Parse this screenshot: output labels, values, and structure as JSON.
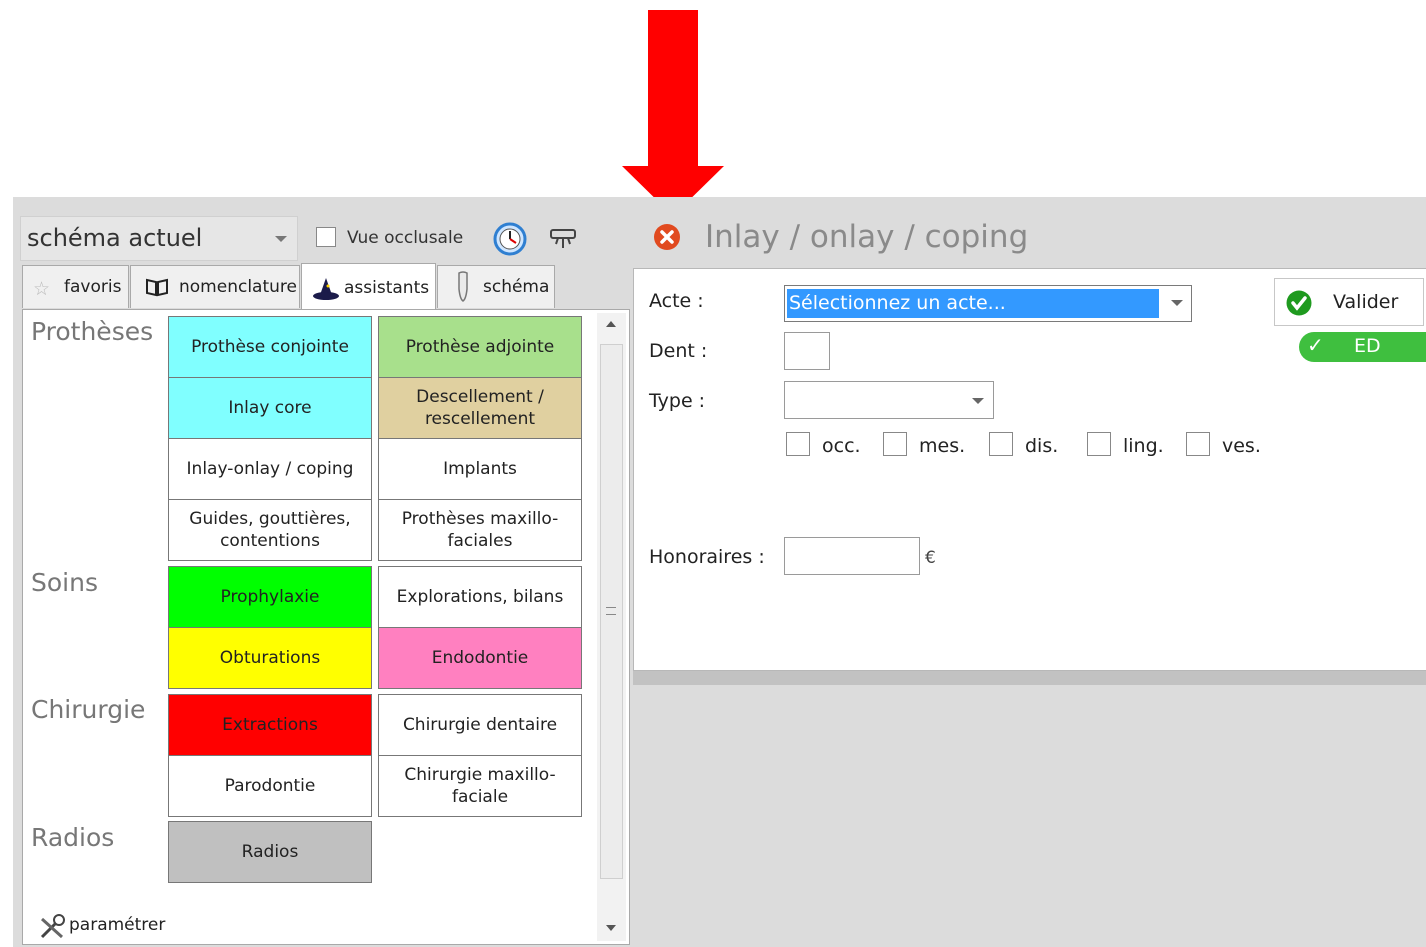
{
  "toolbar": {
    "schema_select_value": "schéma actuel",
    "vue_occlusale_label": "Vue occlusale"
  },
  "tabs": [
    {
      "label": "favoris",
      "icon": "star-icon"
    },
    {
      "label": "nomenclature",
      "icon": "book-icon"
    },
    {
      "label": "assistants",
      "icon": "wizard-icon",
      "active": true
    },
    {
      "label": "schéma",
      "icon": "tooth-icon"
    }
  ],
  "sections": {
    "protheses": "Prothèses",
    "soins": "Soins",
    "chirurgie": "Chirurgie",
    "radios": "Radios"
  },
  "tiles": {
    "prothese_conjointe": {
      "label": "Prothèse conjointe",
      "color": "#80ffff"
    },
    "prothese_adjointe": {
      "label": "Prothèse adjointe",
      "color": "#a8e08c"
    },
    "inlay_core": {
      "label": "Inlay core",
      "color": "#80ffff"
    },
    "descellement": {
      "label": "Descellement / rescellement",
      "color": "#e0d0a0"
    },
    "inlay_onlay": {
      "label": "Inlay-onlay / coping",
      "color": "#ffffff"
    },
    "implants": {
      "label": "Implants",
      "color": "#ffffff"
    },
    "guides": {
      "label": "Guides, gouttières, contentions",
      "color": "#ffffff"
    },
    "protheses_maxillo": {
      "label": "Prothèses maxillo-faciales",
      "color": "#ffffff"
    },
    "prophylaxie": {
      "label": "Prophylaxie",
      "color": "#00ff00"
    },
    "explorations": {
      "label": "Explorations, bilans",
      "color": "#ffffff"
    },
    "obturations": {
      "label": "Obturations",
      "color": "#ffff00"
    },
    "endodontie": {
      "label": "Endodontie",
      "color": "#ff80c0"
    },
    "extractions": {
      "label": "Extractions",
      "color": "#ff0000"
    },
    "chirurgie_dentaire": {
      "label": "Chirurgie dentaire",
      "color": "#ffffff"
    },
    "parodontie": {
      "label": "Parodontie",
      "color": "#ffffff"
    },
    "chirurgie_maxillo": {
      "label": "Chirurgie maxillo-faciale",
      "color": "#ffffff"
    },
    "radios": {
      "label": "Radios",
      "color": "#c0c0c0"
    }
  },
  "parametrer_label": "paramétrer",
  "form": {
    "title": "Inlay / onlay / coping",
    "acte_label": "Acte :",
    "acte_value": "Sélectionnez un acte...",
    "dent_label": "Dent :",
    "type_label": "Type :",
    "faces": [
      "occ.",
      "mes.",
      "dis.",
      "ling.",
      "ves."
    ],
    "honoraires_label": "Honoraires :",
    "currency": "€",
    "valider_label": "Valider",
    "ed_label": "ED"
  }
}
